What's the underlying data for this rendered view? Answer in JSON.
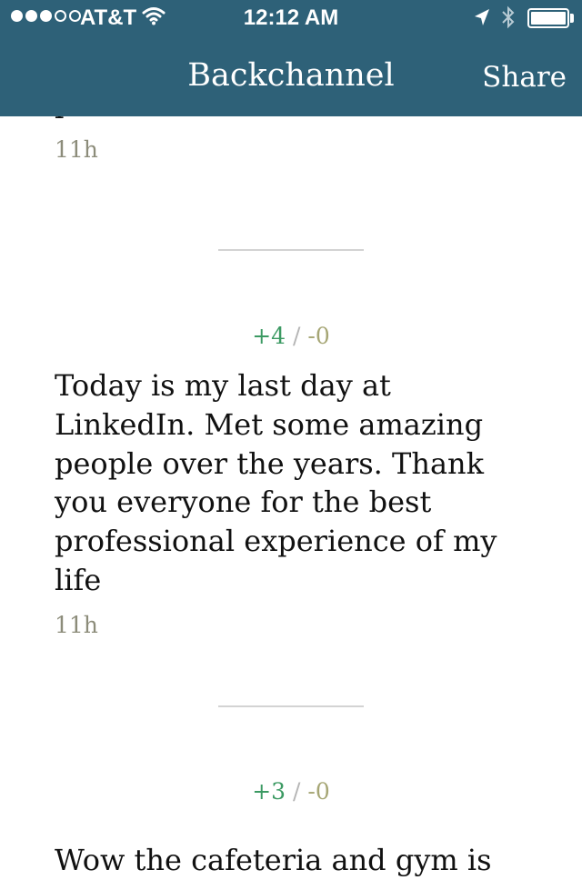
{
  "status_bar": {
    "carrier": "AT&T",
    "time": "12:12 AM",
    "signal_bars_filled": 3,
    "signal_bars_total": 5,
    "battery_level": 1.0
  },
  "nav": {
    "title": "Backchannel",
    "share_label": "Share"
  },
  "posts": [
    {
      "text_visible_fragment": "p",
      "time": "11h"
    },
    {
      "upvotes": "+4",
      "separator": "/",
      "downvotes": "-0",
      "text": "Today is my last day at LinkedIn. Met some amazing people over the years. Thank you everyone for the best professional experience of my life",
      "time": "11h"
    },
    {
      "upvotes": "+3",
      "separator": "/",
      "downvotes": "-0",
      "text": "Wow the cafeteria and gym is"
    }
  ],
  "icons": {
    "wifi": "wifi-icon",
    "location": "location-arrow-icon",
    "bluetooth": "bluetooth-icon",
    "battery": "battery-icon"
  },
  "colors": {
    "nav_bar": "#2e6178",
    "upvote": "#3c9a63",
    "downvote": "#a6a675",
    "timestamp": "#8c8c7a",
    "divider": "#d3d3d3"
  }
}
